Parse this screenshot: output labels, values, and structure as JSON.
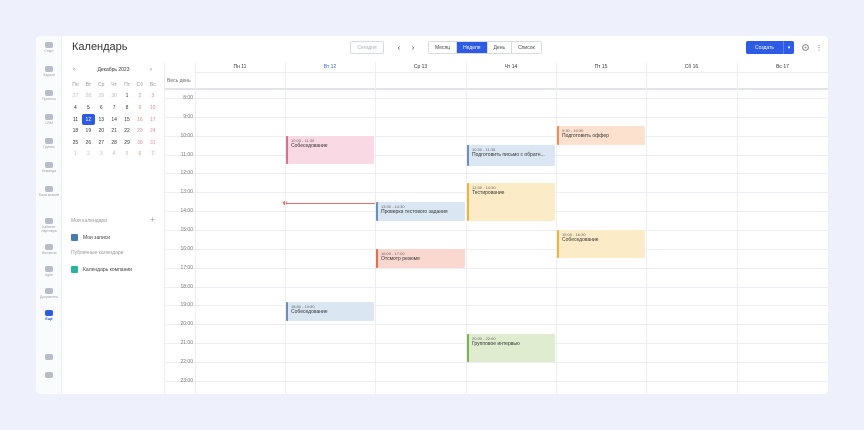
{
  "rail": [
    {
      "label": "Старт",
      "icon": "home-icon"
    },
    {
      "label": "Задачи",
      "icon": "tasks-icon"
    },
    {
      "label": "Проекты",
      "icon": "projects-icon"
    },
    {
      "label": "CRM",
      "icon": "crm-icon"
    },
    {
      "label": "Группы",
      "icon": "groups-icon"
    },
    {
      "label": "Команда",
      "icon": "team-icon"
    },
    {
      "label": "База знаний",
      "icon": "knowledge-icon"
    },
    {
      "label": "Кабинет партнера",
      "icon": "partner-icon"
    },
    {
      "label": "Финансы",
      "icon": "finance-icon"
    },
    {
      "label": "Agile",
      "icon": "agile-icon"
    },
    {
      "label": "Документы",
      "icon": "documents-icon"
    },
    {
      "label": "Ещё",
      "icon": "more-icon"
    }
  ],
  "header": {
    "title": "Календарь",
    "today": "Сегодня",
    "prev": "‹",
    "next": "›",
    "views": [
      "Месяц",
      "Неделя",
      "День",
      "Список"
    ],
    "active_view": "Неделя",
    "create": "Создать",
    "create_arrow": "▾",
    "settings_icon": "gear-icon",
    "more_icon": "⋮"
  },
  "mini": {
    "month": "Декабрь 2023",
    "prev": "‹",
    "next": "›",
    "dow": [
      "Пн",
      "Вт",
      "Ср",
      "Чт",
      "Пт",
      "Сб",
      "Вс"
    ],
    "days": [
      [
        "27",
        "28",
        "29",
        "30",
        "1",
        "2",
        "3"
      ],
      [
        "4",
        "5",
        "6",
        "7",
        "8",
        "9",
        "10"
      ],
      [
        "11",
        "12",
        "13",
        "14",
        "15",
        "16",
        "17"
      ],
      [
        "18",
        "19",
        "20",
        "21",
        "22",
        "23",
        "24"
      ],
      [
        "25",
        "26",
        "27",
        "28",
        "29",
        "30",
        "31"
      ],
      [
        "1",
        "2",
        "3",
        "4",
        "5",
        "6",
        "7"
      ]
    ],
    "selected": "12"
  },
  "calendars": {
    "my_title": "Мои календари",
    "add": "+",
    "my_item": "Мои записи",
    "my_color": "#4a7bb0",
    "public_title": "Публичные календари",
    "public_item": "Календарь компании",
    "public_color": "#2bb39b"
  },
  "week": {
    "days": [
      "Пн 11",
      "Вт 12",
      "Ср 13",
      "Чт 14",
      "Пт 15",
      "Сб 16",
      "Вс 17"
    ],
    "today_index": 1,
    "allday_label": "Весь день",
    "hours": [
      "8:00",
      "9:00",
      "10:00",
      "11:00",
      "12:00",
      "13:00",
      "14:00",
      "15:00",
      "16:00",
      "17:00",
      "18:00",
      "19:00",
      "20:00",
      "21:00",
      "22:00",
      "23:00"
    ]
  },
  "events": [
    {
      "day": 1,
      "time": "10:00 - 11:30",
      "title": "Собеседование",
      "color": "pink"
    },
    {
      "day": 3,
      "time": "10:30 - 11:35",
      "title": "Подготовить письмо с обратн...",
      "color": "blue"
    },
    {
      "day": 4,
      "time": "9:30 - 10:30",
      "title": "Подготовить оффер",
      "color": "orange"
    },
    {
      "day": 3,
      "time": "12:30 - 14:30",
      "title": "Тестирование",
      "color": "yellow"
    },
    {
      "day": 2,
      "time": "13:30 - 14:30",
      "title": "Проверка тестового задания",
      "color": "blue"
    },
    {
      "day": 4,
      "time": "15:00 - 16:30",
      "title": "Собеседование",
      "color": "yellow"
    },
    {
      "day": 2,
      "time": "16:00 - 17:00",
      "title": "Отсмотр резюме",
      "color": "red"
    },
    {
      "day": 1,
      "time": "18:50 - 19:50",
      "title": "Собеседование",
      "color": "blue"
    },
    {
      "day": 3,
      "time": "20:30 - 22:00",
      "title": "Групповое интервью",
      "color": "green"
    }
  ]
}
